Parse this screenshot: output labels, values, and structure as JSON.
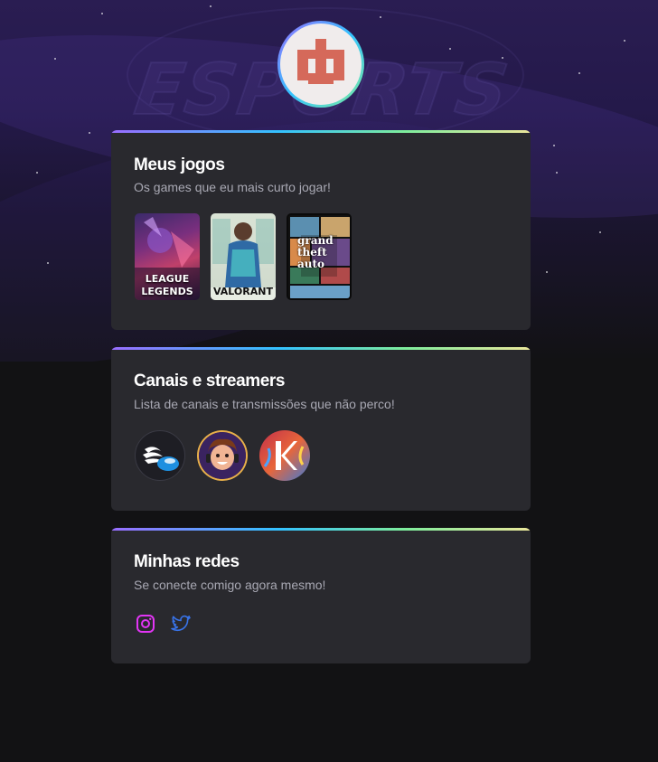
{
  "cards": {
    "games": {
      "title": "Meus jogos",
      "subtitle": "Os games que eu mais curto jogar!",
      "items": [
        {
          "name": "League of Legends",
          "caption_top": "LEAGUE",
          "caption_mid": "OF",
          "caption_bottom": "LEGENDS"
        },
        {
          "name": "Valorant",
          "caption": "VALORANT"
        },
        {
          "name": "Grand Theft Auto V",
          "caption_1": "grand",
          "caption_2": "theft",
          "caption_3": "auto"
        }
      ]
    },
    "streamers": {
      "title": "Canais e streamers",
      "subtitle": "Lista de canais e transmissões que não perco!"
    },
    "socials": {
      "title": "Minhas redes",
      "subtitle": "Se conecte comigo agora mesmo!",
      "icons": [
        "instagram-icon",
        "twitter-icon"
      ],
      "instagram_color": "#e235f5",
      "twitter_color": "#3873e8"
    }
  },
  "accent_gradient": [
    "#996dff",
    "#33c2ff",
    "#7eed9c",
    "#ebe79b"
  ]
}
